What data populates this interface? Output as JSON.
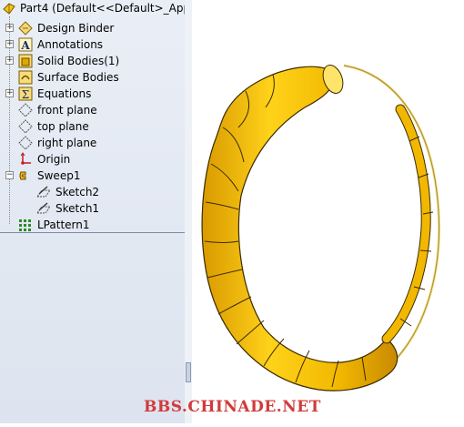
{
  "feature_tree": {
    "root_label": "Part4  (Default<<Default>_App",
    "items": [
      {
        "label": "Design Binder",
        "icon": "design-binder-icon",
        "expandable": true
      },
      {
        "label": "Annotations",
        "icon": "annotations-icon",
        "expandable": true
      },
      {
        "label": "Solid Bodies(1)",
        "icon": "solid-bodies-icon",
        "expandable": true
      },
      {
        "label": "Surface Bodies",
        "icon": "surface-bodies-icon",
        "expandable": false
      },
      {
        "label": "Equations",
        "icon": "equations-icon",
        "expandable": true
      },
      {
        "label": "front plane",
        "icon": "plane-icon",
        "expandable": false
      },
      {
        "label": "top plane",
        "icon": "plane-icon",
        "expandable": false
      },
      {
        "label": "right plane",
        "icon": "plane-icon",
        "expandable": false
      },
      {
        "label": "Origin",
        "icon": "origin-icon",
        "expandable": false
      },
      {
        "label": "Sweep1",
        "icon": "sweep-icon",
        "expandable": true,
        "expanded": true
      },
      {
        "label": "Sketch2",
        "icon": "sketch-icon",
        "child": true
      },
      {
        "label": "Sketch1",
        "icon": "sketch-icon",
        "child": true
      },
      {
        "label": "LPattern1",
        "icon": "linear-pattern-icon",
        "expandable": false
      }
    ]
  },
  "viewport": {
    "model": "swept ring with linear pattern of segments",
    "model_color": "#f2b800",
    "model_shadow_color": "#c98a00"
  },
  "watermark": "BBS.CHINADE.NET"
}
